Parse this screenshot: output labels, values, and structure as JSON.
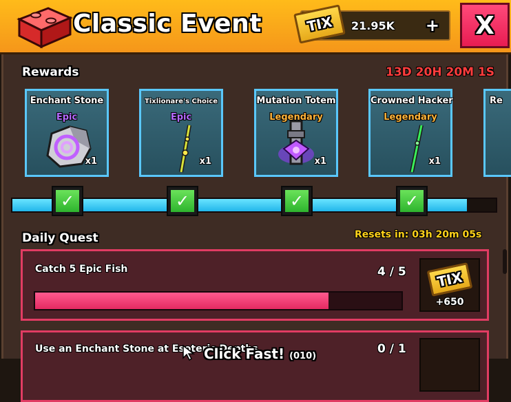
{
  "header": {
    "title": "Classic Event",
    "currency_badge": "TIX",
    "currency_amount": "21.95K",
    "add_label": "+",
    "close_label": "X"
  },
  "rewards": {
    "title": "Rewards",
    "timer": "13D 20H 20M 1S",
    "items": [
      {
        "name": "Enchant Stone",
        "rarity": "Epic",
        "qty": "x1"
      },
      {
        "name": "Tixlionare's Choice",
        "rarity": "Epic",
        "qty": "x1"
      },
      {
        "name": "Mutation Totem",
        "rarity": "Legendary",
        "qty": "x1"
      },
      {
        "name": "Crowned Hacker",
        "rarity": "Legendary",
        "qty": "x1"
      },
      {
        "name": "Re"
      }
    ],
    "progress_fraction": 0.94,
    "check_mark": "✓"
  },
  "daily_quest": {
    "title": "Daily Quest",
    "resets": "Resets in: 03h 20m 05s",
    "quests": [
      {
        "name": "Catch 5 Epic Fish",
        "progress": "4 / 5",
        "progress_fraction": 0.8,
        "reward_badge": "TIX",
        "reward": "+650"
      },
      {
        "name": "Use an Enchant Stone at Esoteric Depths",
        "progress": "0 / 1"
      }
    ]
  },
  "footer": {
    "hint": "Click Fast!",
    "hint_count": "(010)"
  },
  "colors": {
    "header": "#f5a21a",
    "close": "#e81c52",
    "card_border": "#5ac8ff",
    "epic": "#b56bff",
    "legendary": "#ffb43a",
    "quest_border": "#e13c63",
    "timer": "#ff3d3d",
    "resets": "#ffd21a"
  }
}
